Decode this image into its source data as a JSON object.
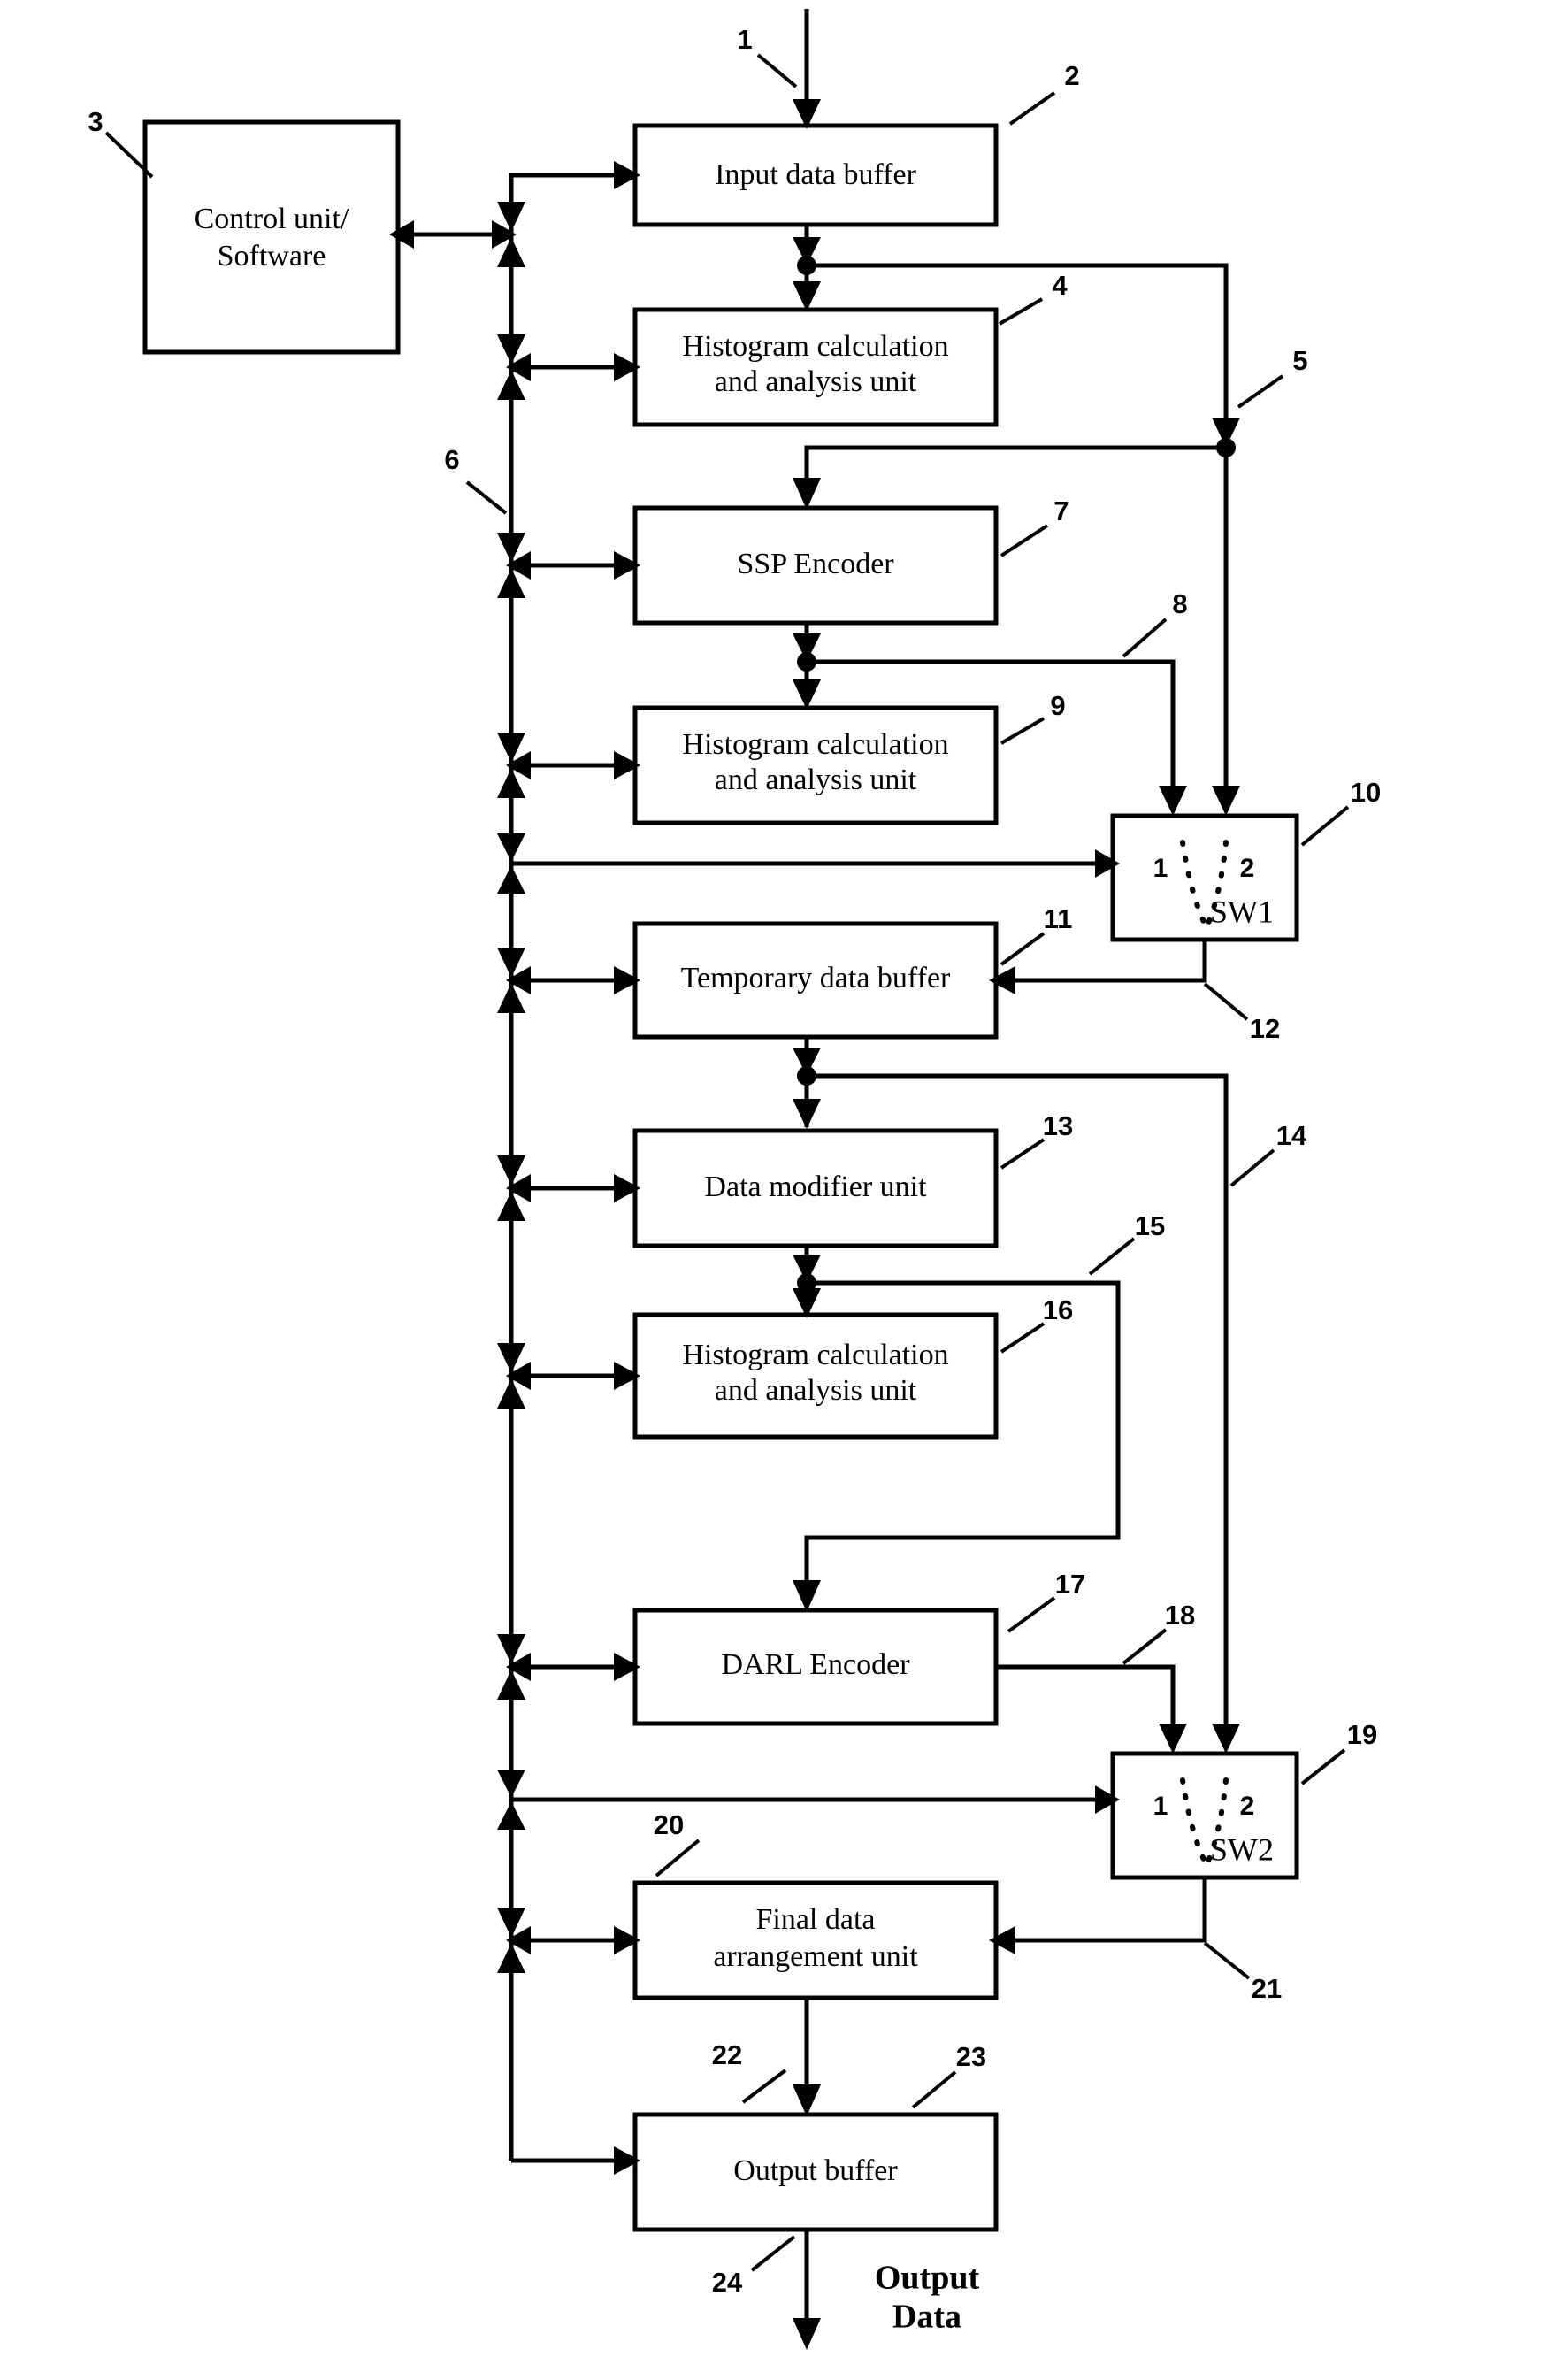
{
  "figure": {
    "kind": "patent-block-diagram",
    "background_color": "#ffffff",
    "line_color": "#000000"
  },
  "blocks": {
    "control_unit": {
      "line1": "Control unit/",
      "line2": "Software",
      "ref": "3"
    },
    "input_buffer": {
      "line1": "Input data buffer",
      "ref": "2"
    },
    "histogram1": {
      "line1": "Histogram calculation",
      "line2": "and analysis unit",
      "ref": "4"
    },
    "ssp_encoder": {
      "line1": "SSP Encoder",
      "ref": "7"
    },
    "histogram2": {
      "line1": "Histogram calculation",
      "line2": "and analysis unit",
      "ref": "9"
    },
    "sw1": {
      "name": "SW1",
      "port1": "1",
      "port2": "2",
      "ref": "10"
    },
    "temp_buffer": {
      "line1": "Temporary data buffer",
      "ref": "11"
    },
    "data_modifier": {
      "line1": "Data modifier unit",
      "ref": "13"
    },
    "histogram3": {
      "line1": "Histogram calculation",
      "line2": "and analysis unit",
      "ref": "16"
    },
    "darl_encoder": {
      "line1": "DARL Encoder",
      "ref": "17"
    },
    "sw2": {
      "name": "SW2",
      "port1": "1",
      "port2": "2",
      "ref": "19"
    },
    "final_arrange": {
      "line1": "Final data",
      "line2": "arrangement unit",
      "ref": "20"
    },
    "output_buffer": {
      "line1": "Output buffer",
      "ref": "23"
    }
  },
  "connector_refs": {
    "input_arrow": "1",
    "bus_to_histogram1": "5",
    "control_bus": "6",
    "ssp_to_sw1": "8",
    "sw1_to_temp": "12",
    "temp_branch_to_sw2": "14",
    "modifier_bypass": "15",
    "darl_to_sw2": "18",
    "sw2_to_final": "21",
    "final_to_output": "22",
    "output_line": "24"
  },
  "output_label": {
    "line1": "Output",
    "line2": "Data"
  }
}
